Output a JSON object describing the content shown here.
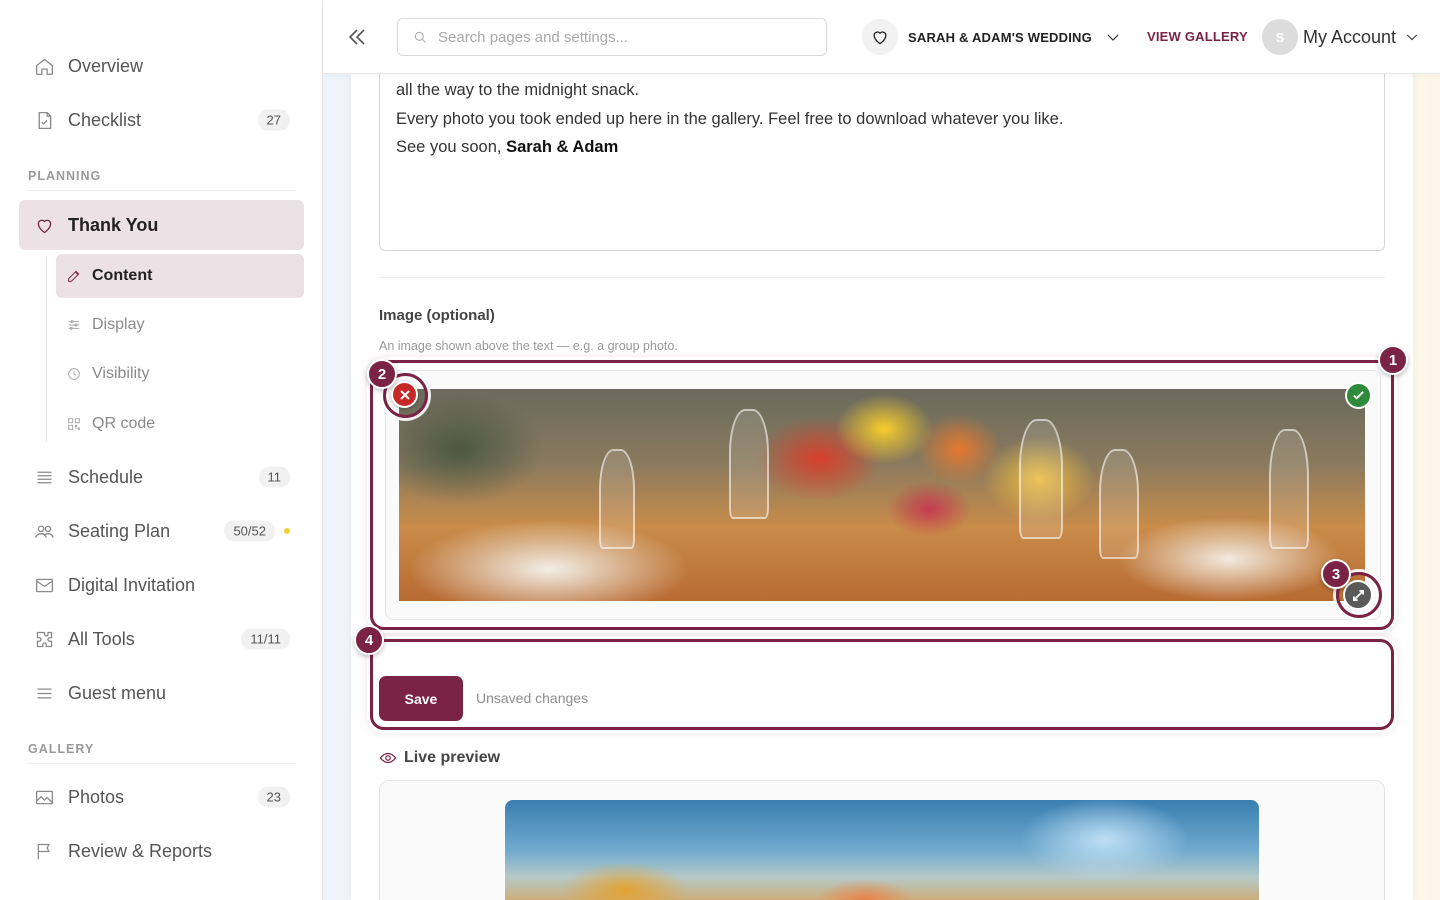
{
  "sidebar": {
    "nav": [
      {
        "label": "Overview",
        "icon": "home-icon"
      },
      {
        "label": "Checklist",
        "icon": "checklist-icon",
        "count": "27"
      }
    ],
    "planning_title": "PLANNING",
    "thank_you": {
      "label": "Thank You",
      "icon": "heart-icon"
    },
    "sub_items": [
      {
        "label": "Content",
        "icon": "edit-icon"
      },
      {
        "label": "Display",
        "icon": "sliders-icon"
      },
      {
        "label": "Visibility",
        "icon": "clock-icon"
      },
      {
        "label": "QR code",
        "icon": "qr-icon"
      }
    ],
    "planning_items": [
      {
        "label": "Schedule",
        "icon": "list-icon",
        "count": "11"
      },
      {
        "label": "Seating Plan",
        "icon": "users-icon",
        "count": "50/52"
      },
      {
        "label": "Digital Invitation",
        "icon": "mail-icon"
      },
      {
        "label": "All Tools",
        "icon": "puzzle-icon",
        "count": "11/11"
      },
      {
        "label": "Guest menu",
        "icon": "menu-icon"
      }
    ],
    "gallery_title": "GALLERY",
    "gallery_items": [
      {
        "label": "Photos",
        "icon": "image-icon",
        "count": "23"
      },
      {
        "label": "Review & Reports",
        "icon": "flag-icon"
      }
    ]
  },
  "header": {
    "search_placeholder": "Search pages and settings...",
    "event_name": "SARAH & ADAM'S WEDDING",
    "view_gallery": "VIEW GALLERY",
    "avatar_initial": "S",
    "account_label": "My Account"
  },
  "content": {
    "text_lines": [
      "all the way to the midnight snack.",
      "Every photo you took ended up here in the gallery. Feel free to download whatever you like."
    ],
    "signoff_prefix": "See you soon, ",
    "signoff_names": "Sarah & Adam",
    "image_label": "Image (optional)",
    "image_help": "An image shown above the text — e.g. a group photo.",
    "save_label": "Save",
    "unsaved_label": "Unsaved changes",
    "live_preview_label": "Live preview"
  },
  "callouts": [
    "1",
    "2",
    "3",
    "4"
  ],
  "colors": {
    "accent": "#7b2345",
    "active_bg": "#ece1e4",
    "remove": "#c62828",
    "success": "#2e8b3a",
    "warning_dot": "#f2d230"
  }
}
